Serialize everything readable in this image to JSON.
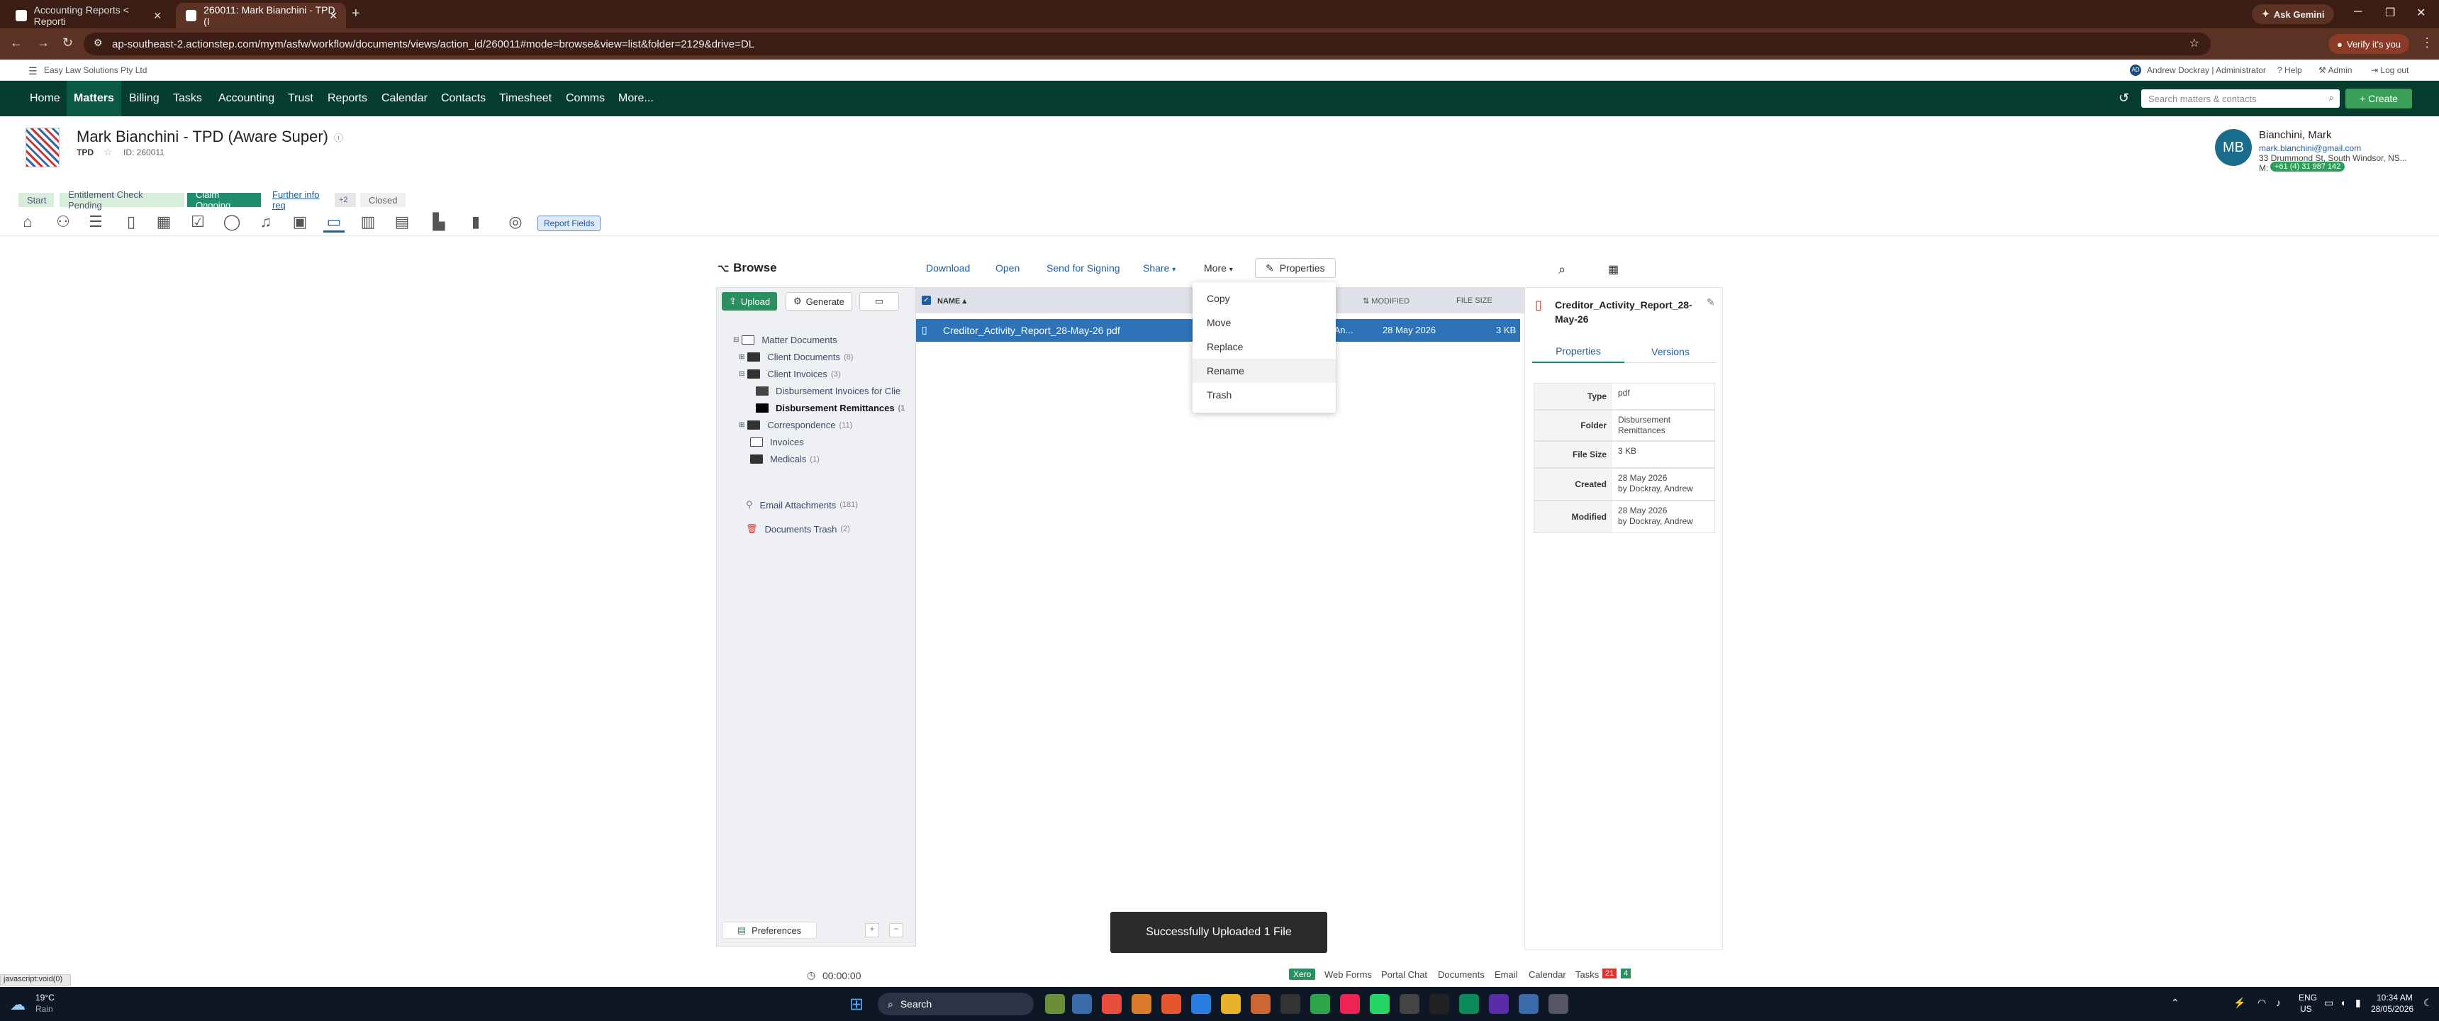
{
  "browser": {
    "tabs": [
      {
        "label": "Accounting Reports < Reporti"
      },
      {
        "label": "260011: Mark Bianchini - TPD (I"
      }
    ],
    "new_tab": "+",
    "url": "ap-southeast-2.actionstep.com/mym/asfw/workflow/documents/views/action_id/260011#mode=browse&view=list&folder=2129&drive=DL",
    "ask_gemini": "Ask Gemini",
    "verify": "Verify it's you"
  },
  "util_bar": {
    "org": "Easy Law Solutions Pty Ltd",
    "user": "Andrew Dockray | Administrator",
    "user_initials": "AD",
    "help": "Help",
    "admin": "Admin",
    "logout": "Log out"
  },
  "main_nav": {
    "items": [
      "Home",
      "Matters",
      "Billing",
      "Tasks",
      "Accounting",
      "Trust",
      "Reports",
      "Calendar",
      "Contacts",
      "Timesheet",
      "Comms",
      "More..."
    ],
    "active": "Matters",
    "search_placeholder": "Search matters & contacts",
    "create": "+ Create"
  },
  "matter": {
    "title": "Mark Bianchini - TPD (Aware Super)",
    "type": "TPD",
    "id": "ID: 260011",
    "contact_initials": "MB",
    "contact_name": "Bianchini, Mark",
    "contact_email": "mark.bianchini@gmail.com",
    "contact_address": "33 Drummond St, South Windsor, NS...",
    "contact_phone_prefix": "M:",
    "contact_phone": "+61 (4) 31 987 142"
  },
  "workflow": {
    "steps": [
      "Start",
      "Entitlement Check Pending",
      "Claim Ongoing",
      "Further info req",
      "+2",
      "Closed"
    ],
    "report_fields": "Report Fields"
  },
  "browse": {
    "title": "Browse",
    "toolbar": [
      "Download",
      "Open",
      "Send for Signing",
      "Share",
      "More",
      "Properties"
    ],
    "upload": "Upload",
    "generate": "Generate",
    "tree": {
      "root": "Matter Documents",
      "items": [
        {
          "label": "Client Documents",
          "count": "(8)"
        },
        {
          "label": "Client Invoices",
          "count": "(3)"
        },
        {
          "label": "Disbursement Invoices for Clie",
          "count": ""
        },
        {
          "label": "Disbursement Remittances",
          "count": "(1"
        },
        {
          "label": "Correspondence",
          "count": "(11)"
        },
        {
          "label": "Invoices",
          "count": ""
        },
        {
          "label": "Medicals",
          "count": "(1)"
        }
      ],
      "email_attachments": "Email Attachments",
      "email_count": "(181)",
      "trash": "Documents Trash",
      "trash_count": "(2)"
    },
    "preferences": "Preferences",
    "columns": {
      "name": "NAME",
      "modified": "MODIFIED",
      "file_size": "FILE SIZE",
      "partial": "Y"
    },
    "row": {
      "name": "Creditor_Activity_Report_28-May-26 pdf",
      "by": "ray, An...",
      "modified": "28 May 2026",
      "size": "3 KB"
    },
    "more_menu": [
      "Copy",
      "Move",
      "Replace",
      "Rename",
      "Trash"
    ],
    "props": {
      "filename": "Creditor_Activity_Report_28-May-26",
      "tabs": [
        "Properties",
        "Versions"
      ],
      "rows": [
        {
          "k": "Type",
          "v": "pdf"
        },
        {
          "k": "Folder",
          "v": "Disbursement Remittances"
        },
        {
          "k": "File Size",
          "v": "3 KB"
        },
        {
          "k": "Created",
          "v": "28 May 2026",
          "v2": "by Dockray, Andrew"
        },
        {
          "k": "Modified",
          "v": "28 May 2026",
          "v2": "by Dockray, Andrew"
        }
      ]
    }
  },
  "toast": "Successfully Uploaded 1 File",
  "bottom": {
    "timer": "00:00:00",
    "links": [
      "Xero",
      "Web Forms",
      "Portal Chat",
      "Documents",
      "Email",
      "Calendar",
      "Tasks"
    ],
    "tasks_red": "21",
    "tasks_green": "4",
    "status_url": "javascript:void(0)"
  },
  "taskbar": {
    "weather_temp": "19°C",
    "weather_desc": "Rain",
    "search": "Search",
    "lang1": "ENG",
    "lang2": "US",
    "time": "10:34 AM",
    "date": "28/05/2026"
  }
}
